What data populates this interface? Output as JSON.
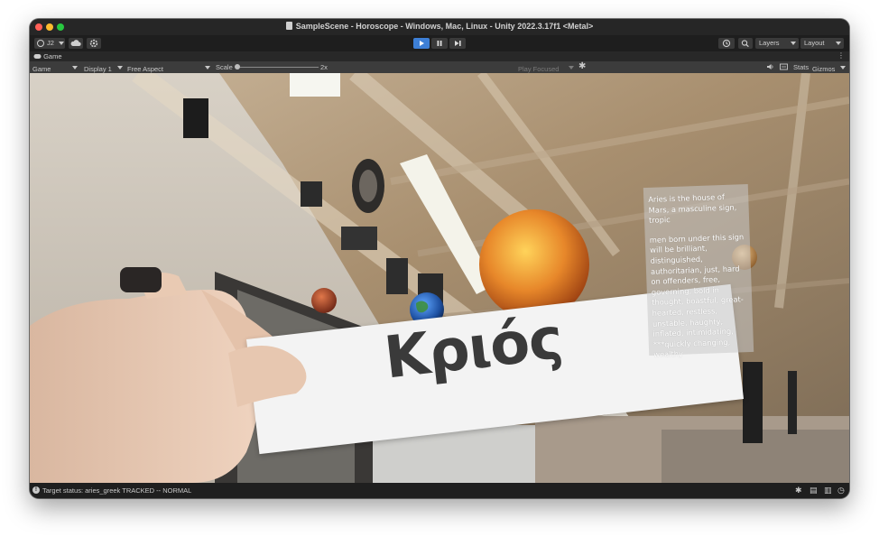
{
  "window": {
    "title": "SampleScene - Horoscope - Windows, Mac, Linux - Unity 2022.3.17f1 <Metal>",
    "traffic_lights": {
      "close": "#ff5f57",
      "minimize": "#febc2e",
      "maximize": "#28c840"
    }
  },
  "toolbar": {
    "account_label": "J2",
    "cloud_icon": "cloud-icon",
    "settings_icon": "gear-icon",
    "play_controls": [
      "play",
      "pause",
      "step"
    ],
    "play_active_color": "#3d7fd6",
    "history_icon": "history-icon",
    "search_icon": "search-icon",
    "layers_label": "Layers",
    "layout_label": "Layout"
  },
  "panel_tab": {
    "label": "Game",
    "icon": "gamepad-icon"
  },
  "game_bar": {
    "game_dropdown": "Game",
    "display_dropdown": "Display 1",
    "aspect_dropdown": "Free Aspect",
    "scale_label": "Scale",
    "scale_value": "2x",
    "play_focused_label": "Play Focused",
    "stats_label": "Stats",
    "gizmos_label": "Gizmos"
  },
  "scene": {
    "card_text": "Κριός",
    "info_panel": {
      "line1": "Aries is the house of Mars, a masculine sign, tropic",
      "line2": "men born under this sign will be brilliant, distinguished, authoritarian, just, hard on offenders, free, governing, bold in thought, boastful, great-hearted, restless, unstable, haughty, inflated, intimidating, ***quickly changing, wealthy"
    }
  },
  "status": {
    "text": "Target status: aries_greek TRACKED -- NORMAL"
  }
}
